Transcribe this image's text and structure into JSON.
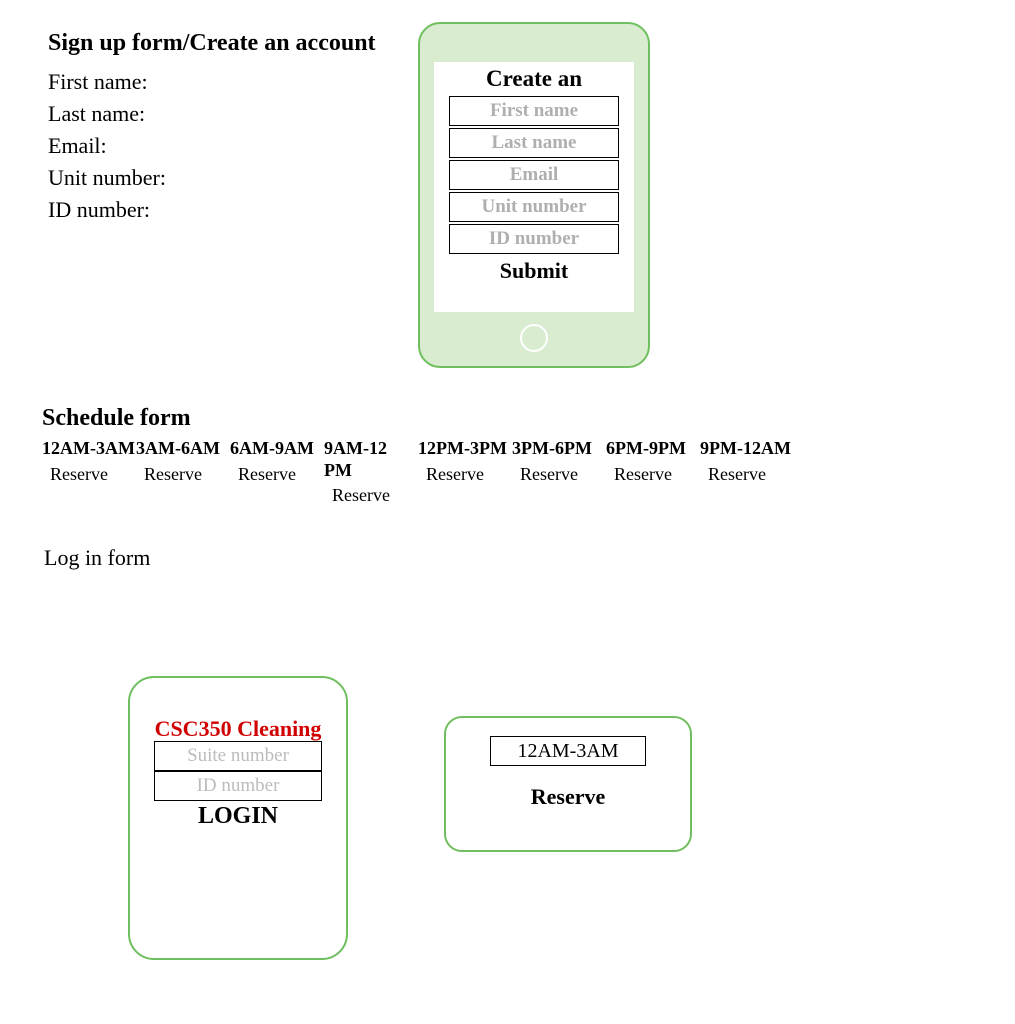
{
  "signup": {
    "heading": "Sign up form/Create an account",
    "labels": {
      "first_name": "First name:",
      "last_name": "Last name:",
      "email": "Email:",
      "unit_number": "Unit number:",
      "id_number": "ID number:"
    }
  },
  "phone_form": {
    "title": "Create an",
    "placeholders": {
      "first_name": "First name",
      "last_name": "Last name",
      "email": "Email",
      "unit_number": "Unit number",
      "id_number": "ID number"
    },
    "submit": "Submit"
  },
  "schedule": {
    "heading": "Schedule form",
    "reserve_label": "Reserve",
    "slots": [
      "12AM-3AM",
      "3AM-6AM",
      "6AM-9AM",
      "9AM-12 PM",
      "12PM-3PM",
      "3PM-6PM",
      "6PM-9PM",
      "9PM-12AM"
    ]
  },
  "login": {
    "heading": "Log in form",
    "brand": "CSC350 Cleaning",
    "placeholders": {
      "suite": "Suite number",
      "id": "ID number"
    },
    "button": "LOGIN"
  },
  "reserve_card": {
    "time": "12AM-3AM",
    "button": "Reserve"
  }
}
